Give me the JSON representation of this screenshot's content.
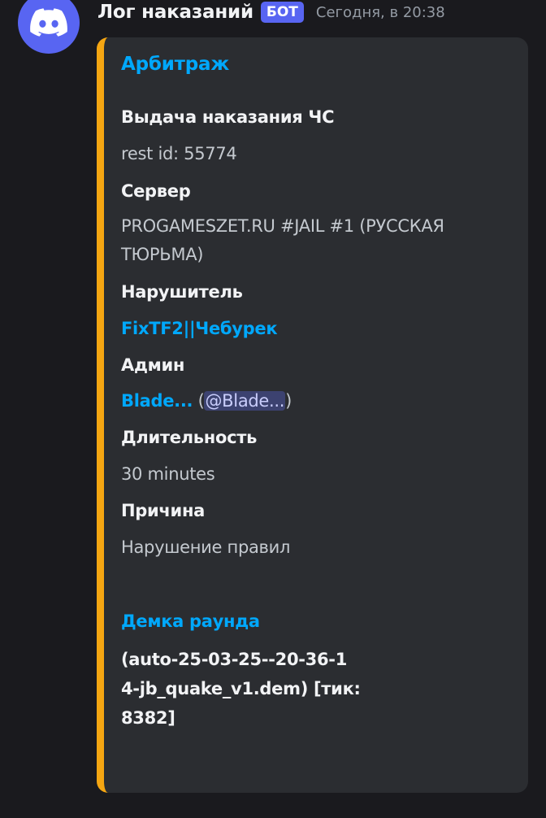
{
  "author": {
    "name": "Лог наказаний",
    "bot_tag": "БОТ",
    "timestamp": "Сегодня, в 20:38",
    "avatar_icon": "discord-logo-icon"
  },
  "embed": {
    "accent_color": "#f5a612",
    "title": "Арбитраж",
    "fields": {
      "action": {
        "name": "Выдача наказания ЧС",
        "value": "rest id: 55774"
      },
      "server": {
        "name": "Сервер",
        "value_line1": "PROGAMESZET.RU #JAIL #1 (РУССКАЯ",
        "value_line2": "ТЮРЬМА)"
      },
      "offender": {
        "name": "Нарушитель",
        "value": "FixTF2||Чебурек"
      },
      "admin": {
        "name": "Админ",
        "value": "Blade...",
        "open_paren": "(",
        "mention": "@Blade...",
        "close_paren": ")"
      },
      "duration": {
        "name": "Длительность",
        "value": "30 minutes"
      },
      "reason": {
        "name": "Причина",
        "value": "Нарушение правил"
      }
    },
    "demo": {
      "name": "Демка раунда",
      "value_line1": "(auto-25-03-25--20-36-1",
      "value_line2": "4-jb_quake_v1.dem) [тик:",
      "value_line3": "8382]"
    }
  }
}
